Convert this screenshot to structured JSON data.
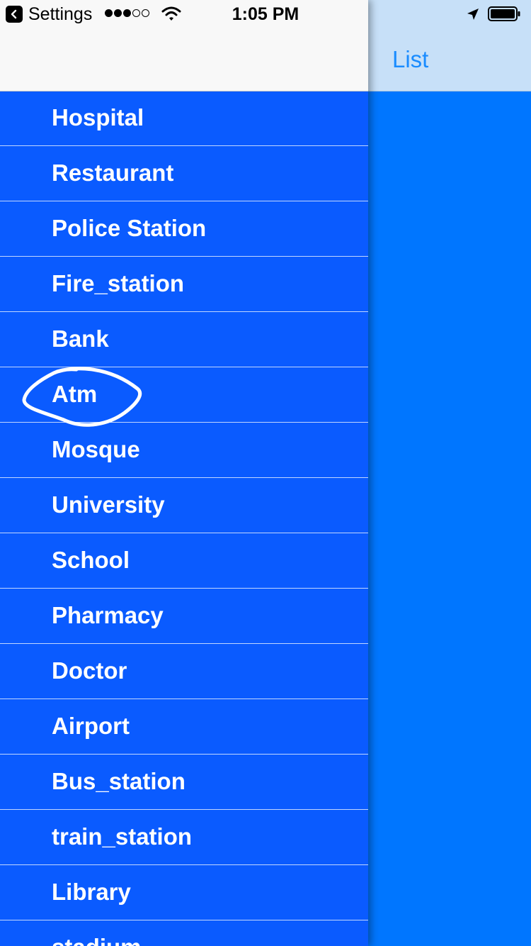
{
  "status_bar": {
    "back_app": "Settings",
    "time": "1:05 PM",
    "signal_bars_filled": 3,
    "signal_bars_total": 5
  },
  "main": {
    "title": "List",
    "background_color": "#0076ff",
    "navbar_color": "#c7e0f8"
  },
  "drawer": {
    "background_color": "#0a5bff",
    "items": [
      {
        "label": "Hospital"
      },
      {
        "label": "Restaurant"
      },
      {
        "label": "Police Station"
      },
      {
        "label": "Fire_station"
      },
      {
        "label": "Bank"
      },
      {
        "label": "Atm"
      },
      {
        "label": "Mosque"
      },
      {
        "label": "University"
      },
      {
        "label": "School"
      },
      {
        "label": "Pharmacy"
      },
      {
        "label": "Doctor"
      },
      {
        "label": "Airport"
      },
      {
        "label": "Bus_station"
      },
      {
        "label": "train_station"
      },
      {
        "label": "Library"
      },
      {
        "label": "stadium"
      }
    ]
  },
  "annotation": {
    "circled_item": "Atm",
    "color": "#ffffff"
  },
  "icons": [
    "back-arrow-icon",
    "wifi-icon",
    "location-arrow-icon",
    "battery-icon"
  ]
}
